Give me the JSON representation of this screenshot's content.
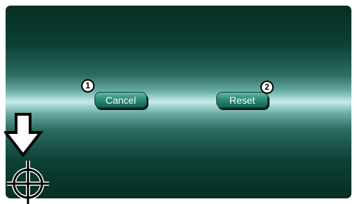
{
  "dialog": {
    "cancel_label": "Cancel",
    "reset_label": "Reset"
  },
  "callouts": {
    "cancel_number": "1",
    "reset_number": "2"
  },
  "icons": {
    "pointer": "down-arrow-icon",
    "target": "crosshair-icon"
  },
  "colors": {
    "background_dark": "#062e24",
    "background_highlight": "#c6ecec",
    "button_fill": "#2f8d78"
  }
}
